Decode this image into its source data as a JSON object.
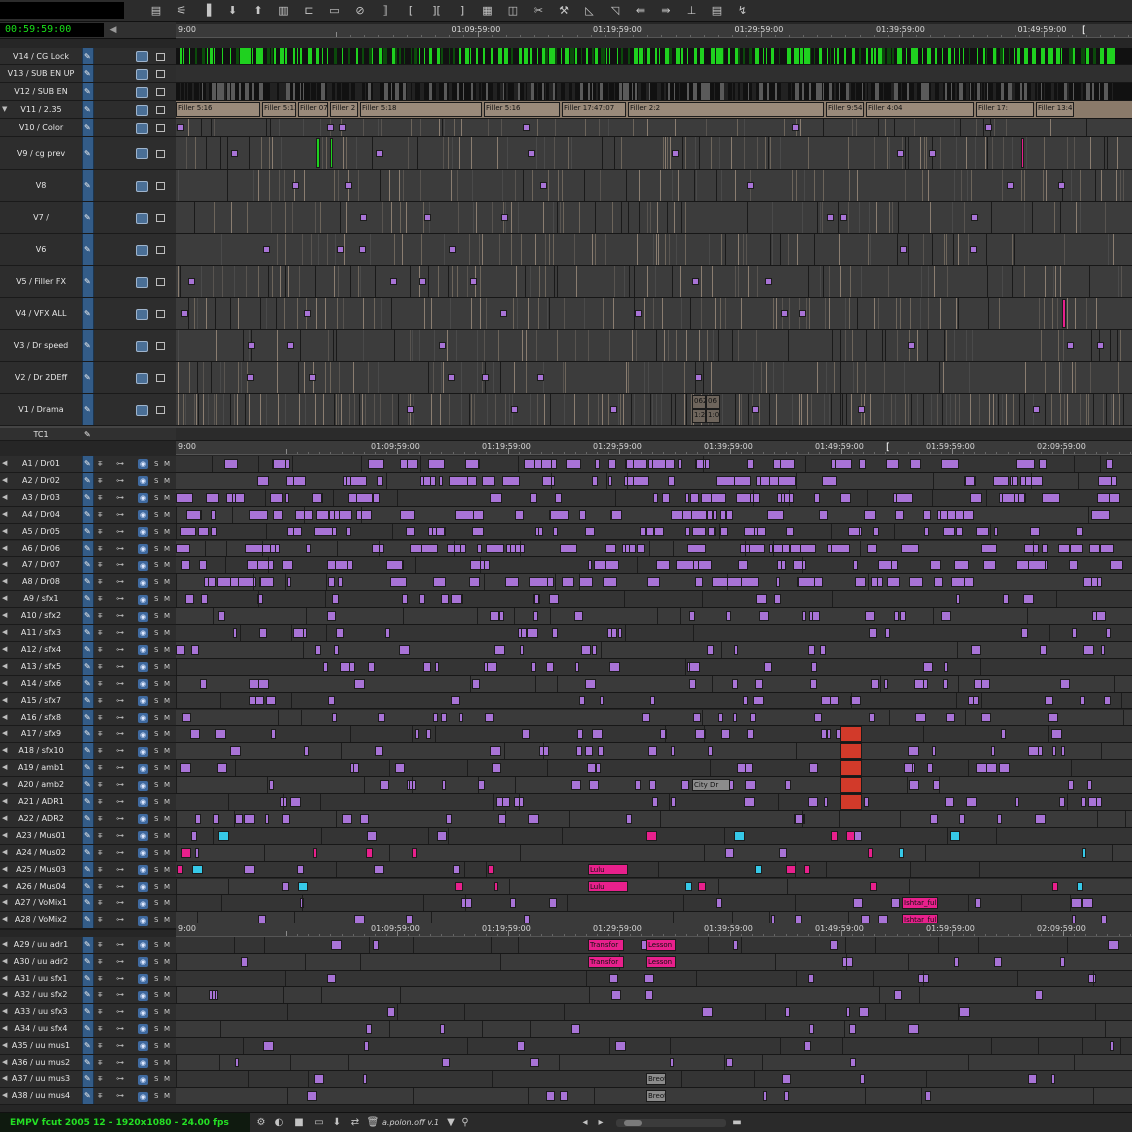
{
  "timecode_display": "",
  "master_timecode": "00:59:59:00",
  "toolbar": {
    "icons": [
      "segment-mode",
      "trim-mode",
      "lift",
      "extract",
      "overwrite",
      "splice",
      "replace",
      "top",
      "tail",
      "mark-clip",
      "mark-in",
      "mark-out",
      "clear-marks",
      "grid",
      "focus",
      "razor",
      "effects",
      "add-edit",
      "lift-overwrite",
      "go-to-in",
      "go-to-out",
      "sync-lock",
      "render",
      "menu"
    ]
  },
  "rulers": [
    {
      "labels": [
        "9:00",
        "01:09:59:00",
        "01:19:59:00",
        "01:29:59:00",
        "01:39:59:00",
        "01:49:59:00",
        "01:59:59:00"
      ],
      "end_mark": "["
    },
    {
      "labels": [
        "9:00",
        "01:09:59:00",
        "01:19:59:00",
        "01:29:59:00",
        "01:39:59:00",
        "01:49:59:00",
        "01:59:59:00",
        "02:09:59:00",
        "02:19:59:00"
      ],
      "end_mark": "["
    },
    {
      "labels": [
        "9:00",
        "01:09:59:00",
        "01:19:59:00",
        "01:29:59:00",
        "01:39:59:00",
        "01:49:59:00",
        "01:59:59:00",
        "02:09:59:00",
        "02:19:59:00"
      ],
      "end_mark": ""
    }
  ],
  "video_tracks": [
    {
      "name": "V14 / CG Lock"
    },
    {
      "name": "V13 / SUB EN UP"
    },
    {
      "name": "V12 / SUB EN"
    },
    {
      "name": "V11 / 2.35"
    },
    {
      "name": "V10 / Color"
    },
    {
      "name": "V9 / cg prev"
    },
    {
      "name": "V8"
    },
    {
      "name": "V7 /"
    },
    {
      "name": "V6"
    },
    {
      "name": "V5 / Filler FX"
    },
    {
      "name": "V4 / VFX ALL"
    },
    {
      "name": "V3 / Dr speed"
    },
    {
      "name": "V2 / Dr 2DEff"
    },
    {
      "name": "V1 / Drama"
    }
  ],
  "tc_track": {
    "name": "TC1"
  },
  "audio_tracks": [
    {
      "name": "A1 / Dr01"
    },
    {
      "name": "A2 / Dr02"
    },
    {
      "name": "A3 / Dr03"
    },
    {
      "name": "A4 / Dr04"
    },
    {
      "name": "A5 / Dr05"
    },
    {
      "name": "A6 / Dr06"
    },
    {
      "name": "A7 / Dr07"
    },
    {
      "name": "A8 / Dr08"
    },
    {
      "name": "A9 / sfx1"
    },
    {
      "name": "A10 / sfx2"
    },
    {
      "name": "A11 / sfx3"
    },
    {
      "name": "A12 / sfx4"
    },
    {
      "name": "A13 / sfx5"
    },
    {
      "name": "A14 / sfx6"
    },
    {
      "name": "A15 / sfx7"
    },
    {
      "name": "A16 / sfx8"
    },
    {
      "name": "A17 / sfx9"
    },
    {
      "name": "A18 / sfx10"
    },
    {
      "name": "A19 / amb1"
    },
    {
      "name": "A20 / amb2"
    },
    {
      "name": "A21 / ADR1"
    },
    {
      "name": "A22 / ADR2"
    },
    {
      "name": "A23 / Mus01"
    },
    {
      "name": "A24 / Mus02"
    },
    {
      "name": "A25 / Mus03"
    },
    {
      "name": "A26 / Mus04"
    },
    {
      "name": "A27 / VoMix1"
    },
    {
      "name": "A28 / VoMix2"
    }
  ],
  "group_label": "24",
  "audio_tracks_2": [
    {
      "name": "A29 / uu adr1"
    },
    {
      "name": "A30 / uu adr2"
    },
    {
      "name": "A31 / uu sfx1"
    },
    {
      "name": "A32 / uu sfx2"
    },
    {
      "name": "A33 / uu sfx3"
    },
    {
      "name": "A34 / uu sfx4"
    },
    {
      "name": "A35 / uu mus1"
    },
    {
      "name": "A36 / uu mus2"
    },
    {
      "name": "A37 / uu mus3"
    },
    {
      "name": "A38 / uu mus4"
    }
  ],
  "clip_labels": {
    "v11": [
      "Filler 5:16",
      "Filler 5:13",
      "Filler 07",
      "Filler 2",
      "Filler 5:18",
      "Filler 5:16",
      "Filler 17:47:07",
      "Filler 2:2",
      "Filler 9:54:01",
      "Filler 4:04",
      "Filler 17:",
      "Filler 13:49:14"
    ],
    "v1": [
      "062",
      "06",
      "1:23",
      "1:0"
    ],
    "a20": [
      "City Dr"
    ],
    "a25": [
      "Lulu"
    ],
    "a26": [
      "Lulu"
    ],
    "a27": [
      "Ishtar_full"
    ],
    "a28": [
      "Ishtar_full"
    ],
    "a29": [
      "Transfor",
      "Lesson"
    ],
    "a30": [
      "Transfor",
      "Lesson"
    ],
    "a37": [
      "Breot"
    ],
    "a38": [
      "Breot"
    ]
  },
  "audio_header_labels": {
    "solo": "S",
    "mute": "M"
  },
  "colors": {
    "green_clip": "#1fd11f",
    "purple_clip": "#a873d6",
    "magenta_clip": "#e8208c",
    "cyan_clip": "#36c9e8",
    "red_clip": "#d23a2a",
    "tan_clip": "#8a7a6a",
    "header_blue": "#335c88",
    "seq_text": "#24e024"
  },
  "bottom_bar": {
    "sequence_info": "EMPV fcut 2005 12 - 1920x1080 - 24.00 fps",
    "bin_name": "a.polon.off v.1"
  }
}
